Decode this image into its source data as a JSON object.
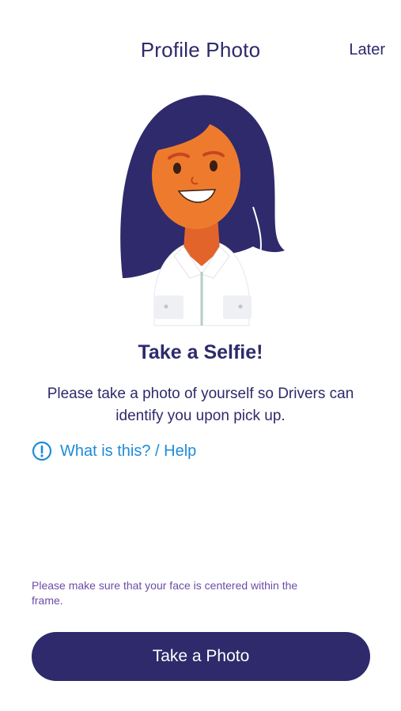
{
  "header": {
    "title": "Profile Photo",
    "later_label": "Later"
  },
  "illustration": {
    "icon": "selfie-woman-illustration",
    "colors": {
      "hair": "#2e2a6b",
      "skin": "#ee7b2d",
      "shirt": "#ffffff"
    }
  },
  "content": {
    "heading": "Take a Selfie!",
    "description": "Please take a photo of yourself so Drivers can identify you upon pick up.",
    "help_label": "What is this? / Help",
    "help_icon": "info-circle-icon"
  },
  "footer": {
    "hint": "Please make sure that your face is centered within the frame.",
    "button_label": "Take a Photo"
  },
  "colors": {
    "primary": "#2e2a6b",
    "link": "#1f8bd8",
    "hint": "#6c4ca8"
  }
}
